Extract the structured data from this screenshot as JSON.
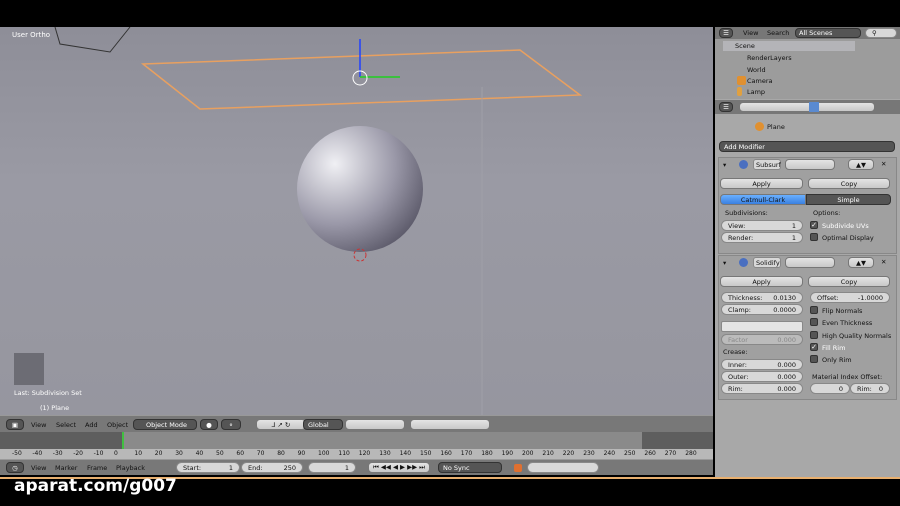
{
  "viewport": {
    "title": "User Ortho",
    "last_op": "Last: Subdivision Set",
    "object_label": "(1) Plane"
  },
  "view3d_header": {
    "menus": [
      "View",
      "Select",
      "Add",
      "Object"
    ],
    "mode": "Object Mode",
    "orientation": "Global"
  },
  "timeline": {
    "ruler": [
      "-50",
      "-40",
      "-30",
      "-20",
      "-10",
      "0",
      "10",
      "20",
      "30",
      "40",
      "50",
      "60",
      "70",
      "80",
      "90",
      "100",
      "110",
      "120",
      "130",
      "140",
      "150",
      "160",
      "170",
      "180",
      "190",
      "200",
      "210",
      "220",
      "230",
      "240",
      "250",
      "260",
      "270",
      "280"
    ],
    "menus": [
      "View",
      "Marker",
      "Frame",
      "Playback"
    ],
    "start_label": "Start:",
    "start": "1",
    "end_label": "End:",
    "end": "250",
    "current": "1",
    "sync": "No Sync"
  },
  "outliner": {
    "menus": [
      "View",
      "Search"
    ],
    "scene_select": "All Scenes",
    "items": [
      "Scene",
      "RenderLayers",
      "World",
      "Camera",
      "Lamp"
    ]
  },
  "properties": {
    "object": "Plane",
    "add_modifier": "Add Modifier",
    "subsurf": {
      "name": "Subsurf",
      "apply": "Apply",
      "copy": "Copy",
      "tabs": [
        "Catmull-Clark",
        "Simple"
      ],
      "subdivisions_label": "Subdivisions:",
      "view_label": "View:",
      "view": "1",
      "render_label": "Render:",
      "render": "1",
      "options_label": "Options:",
      "subdivide_uvs": "Subdivide UVs",
      "optimal_display": "Optimal Display"
    },
    "solidify": {
      "name": "Solidify",
      "apply": "Apply",
      "copy": "Copy",
      "thickness_label": "Thickness:",
      "thickness": "0.0130",
      "offset_label": "Offset:",
      "offset": "-1.0000",
      "clamp_label": "Clamp:",
      "clamp": "0.0000",
      "factor_label": "Factor",
      "factor": "0.000",
      "flip_normals": "Flip Normals",
      "even_thickness": "Even Thickness",
      "hq_normals": "High Quality Normals",
      "fill_rim": "Fill Rim",
      "only_rim": "Only Rim",
      "crease_label": "Crease:",
      "inner_label": "Inner:",
      "inner": "0.000",
      "outer_label": "Outer:",
      "outer": "0.000",
      "rim_label": "Rim:",
      "rim": "0.000",
      "mat_offset_label": "Material Index Offset:",
      "mat_offset": "0",
      "mat_rim_label": "Rim:",
      "mat_rim": "0"
    }
  },
  "watermark": "aparat.com/g007"
}
